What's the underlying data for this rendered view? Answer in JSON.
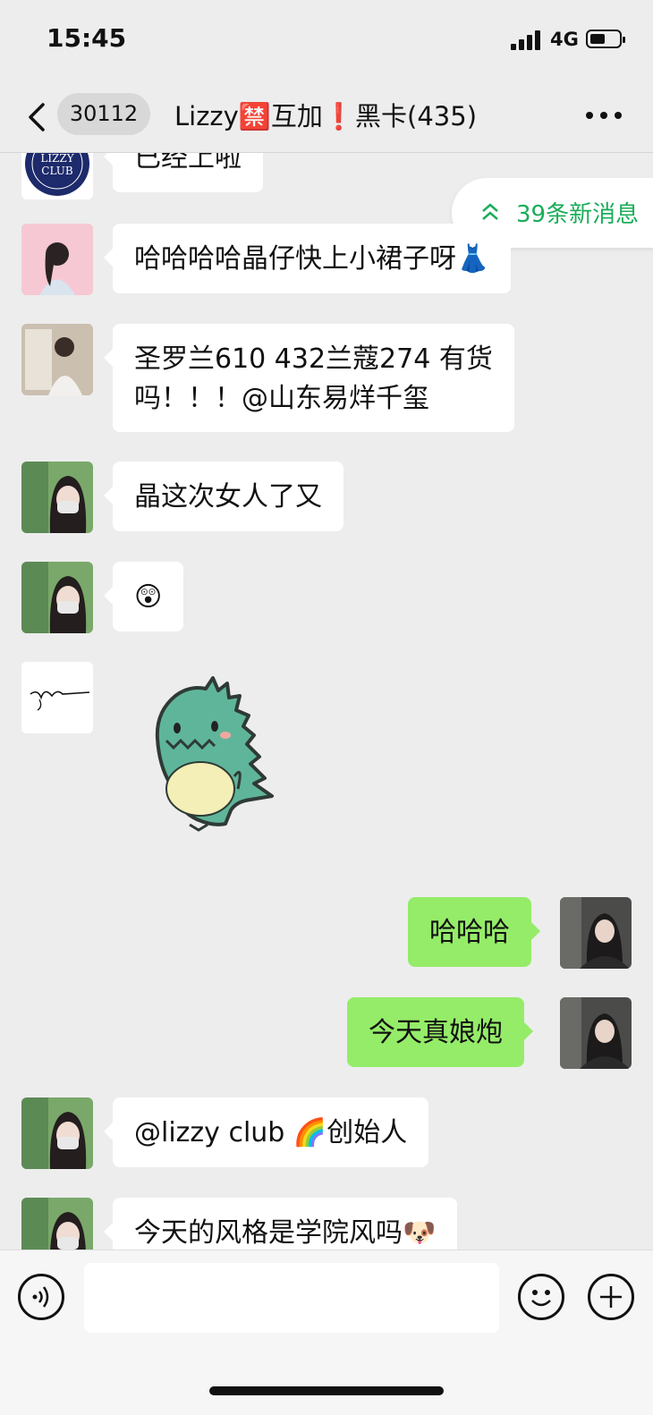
{
  "status": {
    "time": "15:45",
    "network": "4G"
  },
  "header": {
    "unread_count": "30112",
    "title": "Lizzy🈲互加❗️黑卡(435)"
  },
  "new_messages": {
    "label": "39条新消息"
  },
  "messages": [
    {
      "side": "left",
      "text": "已经上啦",
      "avatar": "lizzy-club-logo"
    },
    {
      "side": "left",
      "text": "哈哈哈哈晶仔快上小裙子呀👗",
      "avatar": "girl-pink"
    },
    {
      "side": "left",
      "text": "圣罗兰610 432兰蔻274 有货吗！！！@山东易烊千玺",
      "line1": "圣罗兰610 432兰蔻274 有货",
      "line2": "吗！！！@山东易烊千玺",
      "avatar": "girl-mirror"
    },
    {
      "side": "left",
      "text": "晶这次女人了又",
      "avatar": "girl-mask"
    },
    {
      "side": "left",
      "text": "😲",
      "avatar": "girl-mask"
    },
    {
      "side": "left",
      "sticker": "green-dinosaur",
      "avatar": "signature"
    },
    {
      "side": "right",
      "text": "哈哈哈",
      "avatar": "me"
    },
    {
      "side": "right",
      "text": "今天真娘炮",
      "avatar": "me"
    },
    {
      "side": "left",
      "text": "@lizzy club 🌈创始人",
      "avatar": "girl-mask"
    },
    {
      "side": "left",
      "text": "今天的风格是学院风吗🐶",
      "avatar": "girl-mask"
    }
  ],
  "colors": {
    "accent_green": "#1aad5a",
    "my_bubble": "#95ec69",
    "background": "#ededed"
  }
}
